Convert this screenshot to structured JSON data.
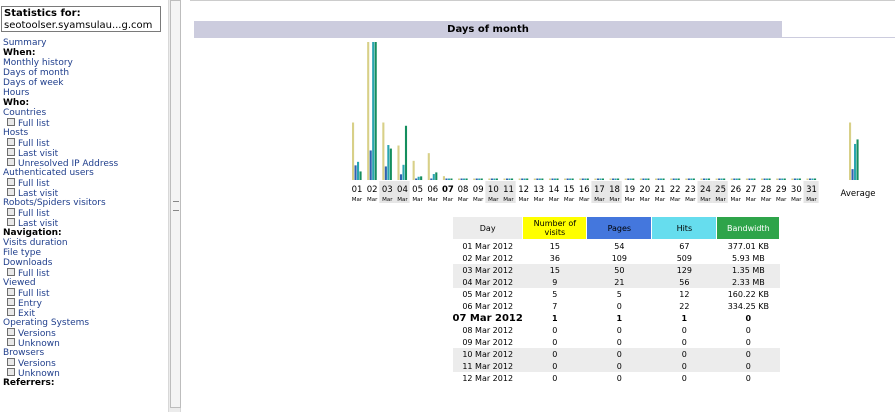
{
  "sidebar": {
    "statistics_for_label": "Statistics for:",
    "site": "seotoolser.syamsulau...g.com",
    "menu": [
      {
        "type": "link",
        "label": "Summary"
      },
      {
        "type": "section",
        "label": "When:"
      },
      {
        "type": "link",
        "label": "Monthly history"
      },
      {
        "type": "link",
        "label": "Days of month"
      },
      {
        "type": "link",
        "label": "Days of week"
      },
      {
        "type": "link",
        "label": "Hours"
      },
      {
        "type": "section",
        "label": "Who:"
      },
      {
        "type": "link",
        "label": "Countries"
      },
      {
        "type": "sub",
        "label": "Full list"
      },
      {
        "type": "link",
        "label": "Hosts"
      },
      {
        "type": "sub",
        "label": "Full list"
      },
      {
        "type": "sub",
        "label": "Last visit"
      },
      {
        "type": "sub",
        "label": "Unresolved IP Address"
      },
      {
        "type": "link",
        "label": "Authenticated users"
      },
      {
        "type": "sub",
        "label": "Full list"
      },
      {
        "type": "sub",
        "label": "Last visit"
      },
      {
        "type": "link",
        "label": "Robots/Spiders visitors"
      },
      {
        "type": "sub",
        "label": "Full list"
      },
      {
        "type": "sub",
        "label": "Last visit"
      },
      {
        "type": "section",
        "label": "Navigation:"
      },
      {
        "type": "link",
        "label": "Visits duration"
      },
      {
        "type": "link",
        "label": "File type"
      },
      {
        "type": "link",
        "label": "Downloads"
      },
      {
        "type": "sub",
        "label": "Full list"
      },
      {
        "type": "link",
        "label": "Viewed"
      },
      {
        "type": "sub",
        "label": "Full list"
      },
      {
        "type": "sub",
        "label": "Entry"
      },
      {
        "type": "sub",
        "label": "Exit"
      },
      {
        "type": "link",
        "label": "Operating Systems"
      },
      {
        "type": "sub",
        "label": "Versions"
      },
      {
        "type": "sub",
        "label": "Unknown"
      },
      {
        "type": "link",
        "label": "Browsers"
      },
      {
        "type": "sub",
        "label": "Versions"
      },
      {
        "type": "sub",
        "label": "Unknown"
      },
      {
        "type": "section",
        "label": "Referrers:"
      }
    ]
  },
  "section_title": "Days of month",
  "colors": {
    "visits": "#d8d088",
    "pages": "#2f62b0",
    "hits": "#2aa5b0",
    "bandwidth": "#148e5e"
  },
  "chart_data": {
    "type": "bar",
    "series_keys": [
      "visits",
      "pages",
      "hits",
      "bandwidth_kb"
    ],
    "days": [
      {
        "d": "01",
        "m": "Mar",
        "we": false,
        "v": 15,
        "p": 54,
        "h": 67,
        "bw": 377.01
      },
      {
        "d": "02",
        "m": "Mar",
        "we": false,
        "v": 36,
        "p": 109,
        "h": 509,
        "bw": 6072.32
      },
      {
        "d": "03",
        "m": "Mar",
        "we": true,
        "v": 15,
        "p": 50,
        "h": 129,
        "bw": 1382.4
      },
      {
        "d": "04",
        "m": "Mar",
        "we": true,
        "v": 9,
        "p": 21,
        "h": 56,
        "bw": 2385.92
      },
      {
        "d": "05",
        "m": "Mar",
        "we": false,
        "v": 5,
        "p": 5,
        "h": 12,
        "bw": 160.22
      },
      {
        "d": "06",
        "m": "Mar",
        "we": false,
        "v": 7,
        "p": 0,
        "h": 22,
        "bw": 334.25
      },
      {
        "d": "07",
        "m": "Mar",
        "we": false,
        "today": true,
        "v": 1,
        "p": 1,
        "h": 1,
        "bw": 0
      },
      {
        "d": "08",
        "m": "Mar",
        "we": false,
        "v": 0,
        "p": 0,
        "h": 0,
        "bw": 0
      },
      {
        "d": "09",
        "m": "Mar",
        "we": false,
        "v": 0,
        "p": 0,
        "h": 0,
        "bw": 0
      },
      {
        "d": "10",
        "m": "Mar",
        "we": true,
        "v": 0,
        "p": 0,
        "h": 0,
        "bw": 0
      },
      {
        "d": "11",
        "m": "Mar",
        "we": true,
        "v": 0,
        "p": 0,
        "h": 0,
        "bw": 0
      },
      {
        "d": "12",
        "m": "Mar",
        "we": false,
        "v": 0,
        "p": 0,
        "h": 0,
        "bw": 0
      },
      {
        "d": "13",
        "m": "Mar",
        "we": false,
        "v": 0,
        "p": 0,
        "h": 0,
        "bw": 0
      },
      {
        "d": "14",
        "m": "Mar",
        "we": false,
        "v": 0,
        "p": 0,
        "h": 0,
        "bw": 0
      },
      {
        "d": "15",
        "m": "Mar",
        "we": false,
        "v": 0,
        "p": 0,
        "h": 0,
        "bw": 0
      },
      {
        "d": "16",
        "m": "Mar",
        "we": false,
        "v": 0,
        "p": 0,
        "h": 0,
        "bw": 0
      },
      {
        "d": "17",
        "m": "Mar",
        "we": true,
        "v": 0,
        "p": 0,
        "h": 0,
        "bw": 0
      },
      {
        "d": "18",
        "m": "Mar",
        "we": true,
        "v": 0,
        "p": 0,
        "h": 0,
        "bw": 0
      },
      {
        "d": "19",
        "m": "Mar",
        "we": false,
        "v": 0,
        "p": 0,
        "h": 0,
        "bw": 0
      },
      {
        "d": "20",
        "m": "Mar",
        "we": false,
        "v": 0,
        "p": 0,
        "h": 0,
        "bw": 0
      },
      {
        "d": "21",
        "m": "Mar",
        "we": false,
        "v": 0,
        "p": 0,
        "h": 0,
        "bw": 0
      },
      {
        "d": "22",
        "m": "Mar",
        "we": false,
        "v": 0,
        "p": 0,
        "h": 0,
        "bw": 0
      },
      {
        "d": "23",
        "m": "Mar",
        "we": false,
        "v": 0,
        "p": 0,
        "h": 0,
        "bw": 0
      },
      {
        "d": "24",
        "m": "Mar",
        "we": true,
        "v": 0,
        "p": 0,
        "h": 0,
        "bw": 0
      },
      {
        "d": "25",
        "m": "Mar",
        "we": true,
        "v": 0,
        "p": 0,
        "h": 0,
        "bw": 0
      },
      {
        "d": "26",
        "m": "Mar",
        "we": false,
        "v": 0,
        "p": 0,
        "h": 0,
        "bw": 0
      },
      {
        "d": "27",
        "m": "Mar",
        "we": false,
        "v": 0,
        "p": 0,
        "h": 0,
        "bw": 0
      },
      {
        "d": "28",
        "m": "Mar",
        "we": false,
        "v": 0,
        "p": 0,
        "h": 0,
        "bw": 0
      },
      {
        "d": "29",
        "m": "Mar",
        "we": false,
        "v": 0,
        "p": 0,
        "h": 0,
        "bw": 0
      },
      {
        "d": "30",
        "m": "Mar",
        "we": false,
        "v": 0,
        "p": 0,
        "h": 0,
        "bw": 0
      },
      {
        "d": "31",
        "m": "Mar",
        "we": true,
        "v": 0,
        "p": 0,
        "h": 0,
        "bw": 0
      }
    ],
    "average": {
      "label": "Average",
      "v": 15,
      "p": 40,
      "h": 133,
      "bw": 1785.7
    }
  },
  "table": {
    "headers": [
      "Day",
      "Number of visits",
      "Pages",
      "Hits",
      "Bandwidth"
    ],
    "rows": [
      {
        "day": "01 Mar 2012",
        "v": "15",
        "p": "54",
        "h": "67",
        "bw": "377.01 KB",
        "alt": false
      },
      {
        "day": "02 Mar 2012",
        "v": "36",
        "p": "109",
        "h": "509",
        "bw": "5.93 MB",
        "alt": false
      },
      {
        "day": "03 Mar 2012",
        "v": "15",
        "p": "50",
        "h": "129",
        "bw": "1.35 MB",
        "alt": true
      },
      {
        "day": "04 Mar 2012",
        "v": "9",
        "p": "21",
        "h": "56",
        "bw": "2.33 MB",
        "alt": true
      },
      {
        "day": "05 Mar 2012",
        "v": "5",
        "p": "5",
        "h": "12",
        "bw": "160.22 KB",
        "alt": false
      },
      {
        "day": "06 Mar 2012",
        "v": "7",
        "p": "0",
        "h": "22",
        "bw": "334.25 KB",
        "alt": false
      },
      {
        "day": "07 Mar 2012",
        "v": "1",
        "p": "1",
        "h": "1",
        "bw": "0",
        "alt": false,
        "today": true
      },
      {
        "day": "08 Mar 2012",
        "v": "0",
        "p": "0",
        "h": "0",
        "bw": "0",
        "alt": false
      },
      {
        "day": "09 Mar 2012",
        "v": "0",
        "p": "0",
        "h": "0",
        "bw": "0",
        "alt": false
      },
      {
        "day": "10 Mar 2012",
        "v": "0",
        "p": "0",
        "h": "0",
        "bw": "0",
        "alt": true
      },
      {
        "day": "11 Mar 2012",
        "v": "0",
        "p": "0",
        "h": "0",
        "bw": "0",
        "alt": true
      },
      {
        "day": "12 Mar 2012",
        "v": "0",
        "p": "0",
        "h": "0",
        "bw": "0",
        "alt": false
      }
    ]
  }
}
